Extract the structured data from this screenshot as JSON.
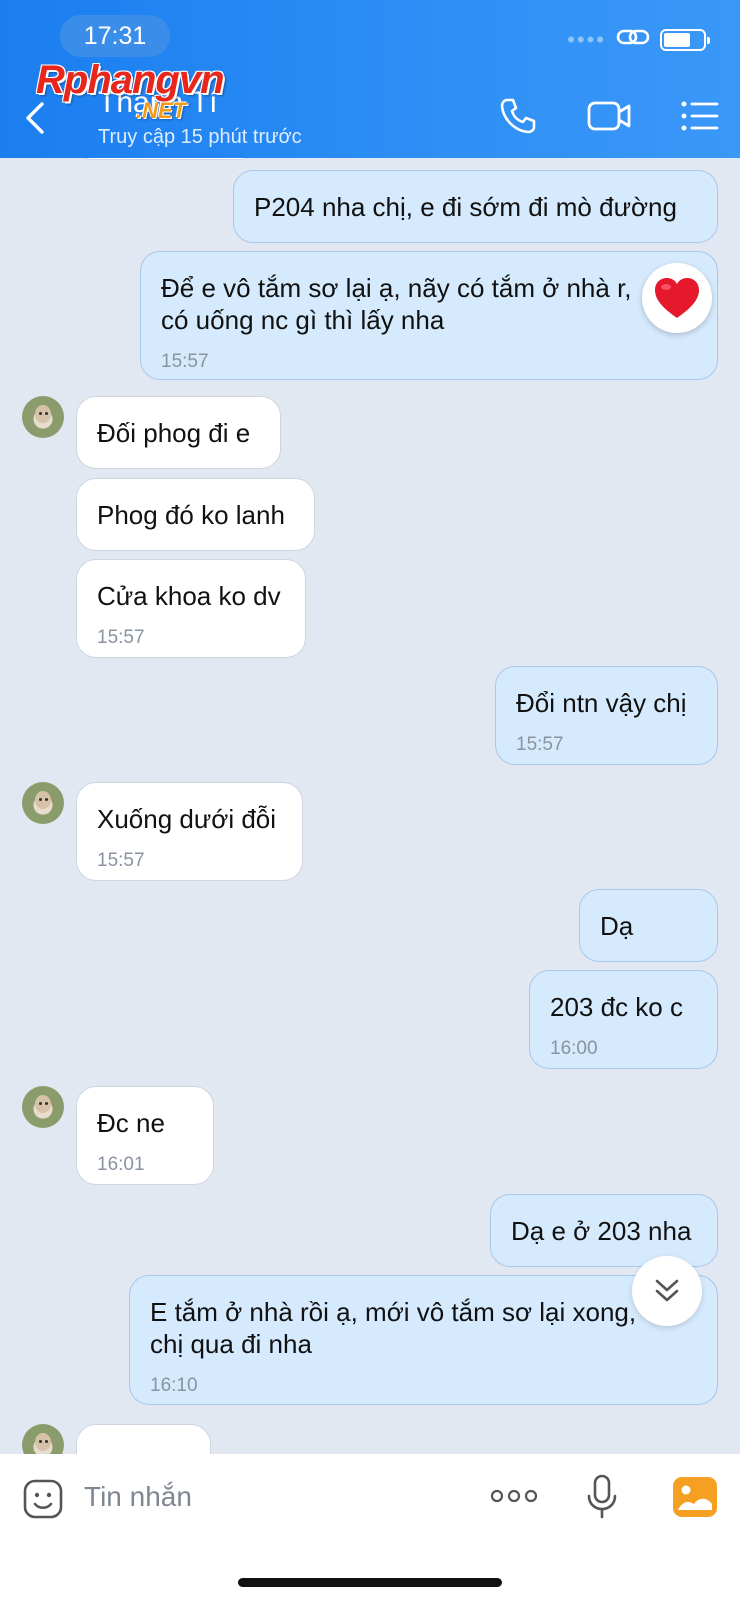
{
  "status_bar": {
    "time": "17:31",
    "signal_dots": "••••"
  },
  "header": {
    "contact_name": "Thanh Tí",
    "contact_status": "Truy cập 15 phút trước",
    "watermark_main": "Rphangvn",
    "watermark_suffix": ".NET"
  },
  "messages": [
    {
      "dir": "out",
      "text": "P204 nha chị, e đi sớm đi mò đường",
      "time": ""
    },
    {
      "dir": "out",
      "text": "Để e vô tắm sơ lại ạ, nãy có tắm ở nhà r, có uống nc gì thì lấy nha",
      "time": "15:57",
      "reaction": "heart"
    },
    {
      "dir": "in",
      "text": "Đối phog đi e",
      "time": ""
    },
    {
      "dir": "in",
      "text": "Phog đó ko lanh",
      "time": ""
    },
    {
      "dir": "in",
      "text": "Cửa khoa ko dv",
      "time": "15:57"
    },
    {
      "dir": "out",
      "text": "Đổi ntn vậy chị",
      "time": "15:57"
    },
    {
      "dir": "in",
      "text": "Xuống dưới đỗi",
      "time": "15:57"
    },
    {
      "dir": "out",
      "text": "Dạ",
      "time": ""
    },
    {
      "dir": "out",
      "text": "203 đc ko c",
      "time": "16:00"
    },
    {
      "dir": "in",
      "text": "Đc ne",
      "time": "16:01"
    },
    {
      "dir": "out",
      "text": "Dạ e ở 203 nha",
      "time": ""
    },
    {
      "dir": "out",
      "text": "E tắm ở nhà rồi ạ, mới vô tắm sơ lại xong, chị qua đi nha",
      "time": "16:10"
    }
  ],
  "input_bar": {
    "placeholder": "Tin nhắn"
  },
  "colors": {
    "header": "#2486f3",
    "chat_bg": "#e2e8f1",
    "out_bubble": "#d5eafd",
    "in_bubble": "#ffffff",
    "photo_icon": "#f5a023"
  }
}
